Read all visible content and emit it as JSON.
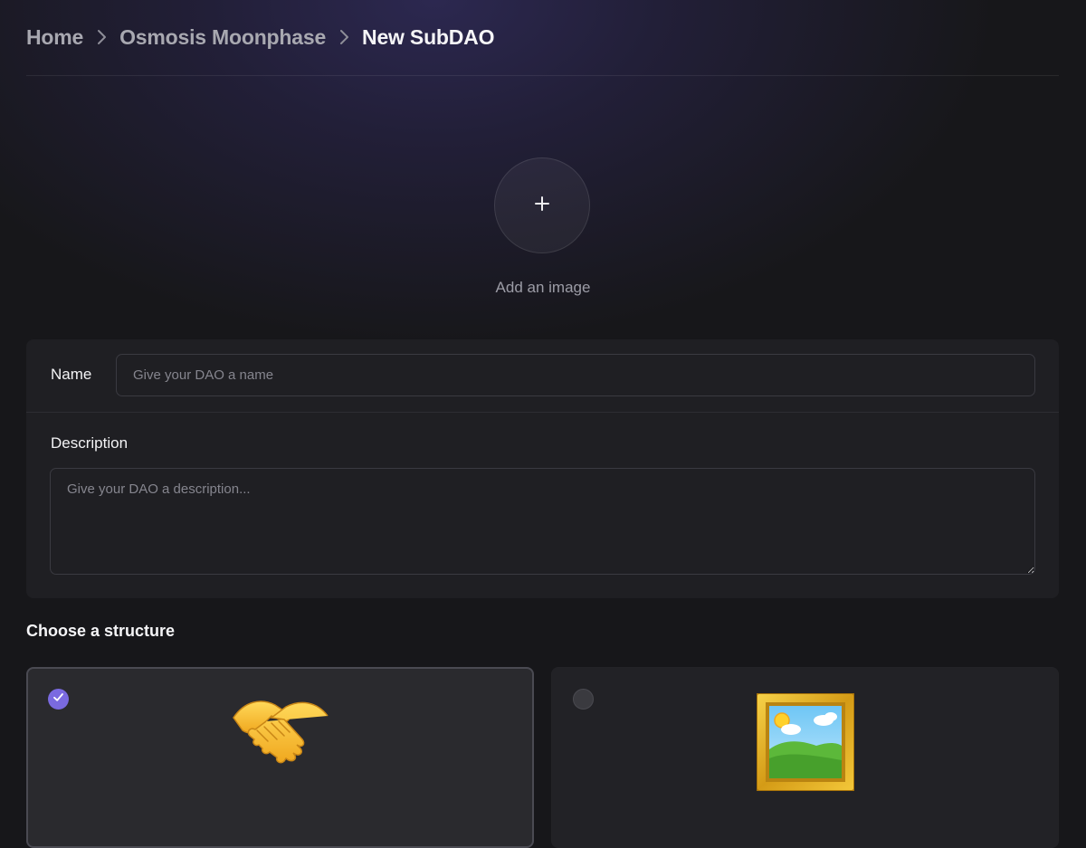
{
  "breadcrumb": {
    "items": [
      "Home",
      "Osmosis Moonphase"
    ],
    "current": "New SubDAO"
  },
  "image_upload": {
    "button_icon": "plus-icon",
    "label": "Add an image"
  },
  "form": {
    "name_label": "Name",
    "name_placeholder": "Give your DAO a name",
    "name_value": "",
    "description_label": "Description",
    "description_placeholder": "Give your DAO a description...",
    "description_value": ""
  },
  "structure": {
    "title": "Choose a structure",
    "options": [
      {
        "icon": "handshake-icon",
        "selected": true
      },
      {
        "icon": "framed-picture-icon",
        "selected": false
      }
    ]
  },
  "colors": {
    "accent": "#7a6ae0",
    "background": "#17171a",
    "card": "#1f1f23"
  }
}
